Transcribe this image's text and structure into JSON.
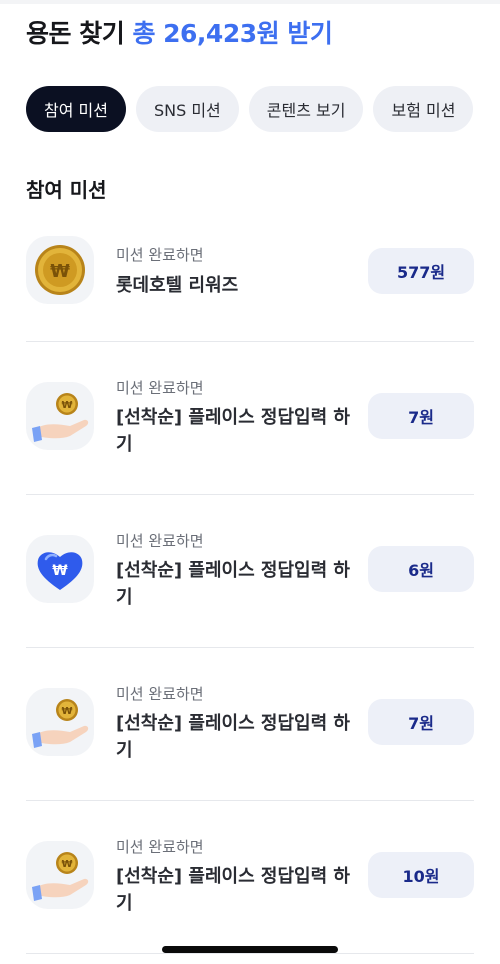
{
  "header": {
    "title": "용돈 찾기",
    "reward": "총 26,423원 받기"
  },
  "tabs": [
    {
      "label": "참여 미션",
      "active": true
    },
    {
      "label": "SNS 미션",
      "active": false
    },
    {
      "label": "콘텐츠 보기",
      "active": false
    },
    {
      "label": "보험 미션",
      "active": false
    }
  ],
  "section": {
    "title": "참여 미션"
  },
  "missions": [
    {
      "subtitle": "미션 완료하면",
      "name": "롯데호텔 리워즈",
      "reward": "577원",
      "icon": "gold-coin-icon"
    },
    {
      "subtitle": "미션 완료하면",
      "name": "[선착순] 플레이스 정답입력 하기",
      "reward": "7원",
      "icon": "coin-hand-icon"
    },
    {
      "subtitle": "미션 완료하면",
      "name": "[선착순] 플레이스 정답입력 하기",
      "reward": "6원",
      "icon": "blue-heart-icon"
    },
    {
      "subtitle": "미션 완료하면",
      "name": "[선착순] 플레이스 정답입력 하기",
      "reward": "7원",
      "icon": "coin-hand-icon"
    },
    {
      "subtitle": "미션 완료하면",
      "name": "[선착순] 플레이스 정답입력 하기",
      "reward": "10원",
      "icon": "coin-hand-icon"
    }
  ],
  "colors": {
    "accent": "#3d6ff0",
    "tab_active_bg": "#0b1022",
    "tab_bg": "#eef0f5",
    "reward_button_bg": "#edf0f8",
    "reward_button_text": "#1a2a8a"
  }
}
